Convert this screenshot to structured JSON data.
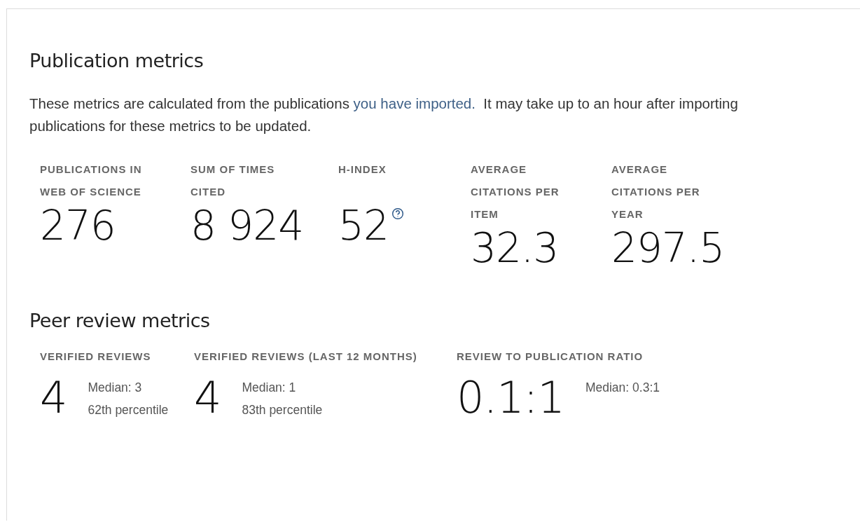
{
  "publication_metrics": {
    "title": "Publication metrics",
    "description": {
      "before": "These metrics are calculated from the publications",
      "link": "you have imported.",
      "after": "It may take up to an hour after importing publications for these metrics to be updated."
    },
    "metrics": [
      {
        "label": "PUBLICATIONS IN WEB OF SCIENCE",
        "value": "276",
        "help": false
      },
      {
        "label": "SUM OF TIMES CITED",
        "value": "8 924",
        "help": false
      },
      {
        "label": "H-INDEX",
        "value": "52",
        "help": true
      },
      {
        "label": "AVERAGE CITATIONS PER ITEM",
        "value": "32.3",
        "help": false
      },
      {
        "label": "AVERAGE CITATIONS PER YEAR",
        "value": "297.5",
        "help": false
      }
    ]
  },
  "peer_review_metrics": {
    "title": "Peer review metrics",
    "metrics": [
      {
        "label": "VERIFIED REVIEWS",
        "value": "4",
        "median": "Median: 3",
        "percentile": "62th percentile"
      },
      {
        "label": "VERIFIED REVIEWS (LAST 12 MONTHS)",
        "value": "4",
        "median": "Median: 1",
        "percentile": "83th percentile"
      },
      {
        "label": "REVIEW TO PUBLICATION RATIO",
        "value": "0.1:1",
        "median": "Median: 0.3:1"
      }
    ]
  }
}
